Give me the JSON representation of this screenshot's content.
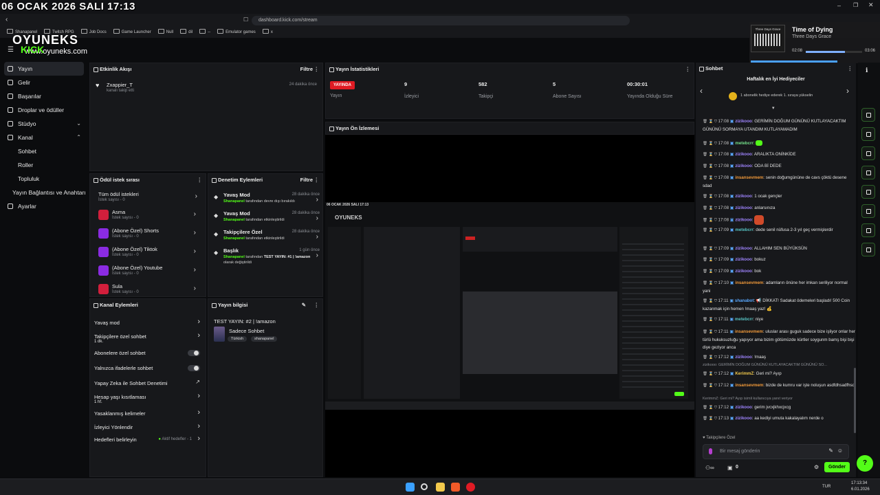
{
  "overlay": {
    "datetime": "06 OCAK 2026 SALI 17:13",
    "brand": "OYUNEKS",
    "brand_site": "www.oyuneks.com",
    "brand_sub": "KICK"
  },
  "browser": {
    "url": "dashboard.kick.com/stream",
    "bookmarks": [
      "Shanapanel",
      "Twitch RPG",
      "Job Docs",
      "Game Launcher",
      "Null",
      "dil",
      "--",
      "Emulator games",
      "x"
    ]
  },
  "media": {
    "title": "Time of Dying",
    "artist": "Three Days Grace",
    "elapsed": "02:08",
    "total": "03:06",
    "album_text": "Three Days Grace",
    "progress": 0.69
  },
  "sidebar": {
    "items": [
      {
        "label": "Yayın",
        "icon": "broadcast-icon"
      },
      {
        "label": "Gelir",
        "icon": "money-icon"
      },
      {
        "label": "Başarılar",
        "icon": "trophy-icon"
      },
      {
        "label": "Droplar ve ödüller",
        "icon": "gift-icon"
      },
      {
        "label": "Stüdyo",
        "icon": "studio-icon"
      },
      {
        "label": "Kanal",
        "icon": "channel-icon"
      },
      {
        "label": "Sohbet"
      },
      {
        "label": "Roller"
      },
      {
        "label": "Topluluk"
      },
      {
        "label": "Yayın Bağlantısı ve Anahtarı"
      },
      {
        "label": "Ayarlar",
        "icon": "settings-icon"
      }
    ]
  },
  "activity": {
    "title": "Etkinlik Akışı",
    "filter": "Filtre",
    "events": [
      {
        "user": "Zxappier_T",
        "text": "kanalı takip etti",
        "time": "24 dakika önce"
      }
    ]
  },
  "stats": {
    "title": "Yayın İstatistikleri",
    "items": [
      {
        "value": "YAYINDA",
        "label": "Yayın"
      },
      {
        "value": "9",
        "label": "İzleyici"
      },
      {
        "value": "582",
        "label": "Takipçi"
      },
      {
        "value": "5",
        "label": "Abone Sayısı"
      },
      {
        "value": "00:30:01",
        "label": "Yayında Olduğu Süre"
      }
    ]
  },
  "preview": {
    "title": "Yayın Ön İzlemesi",
    "inner_banner": "06 OCAK 2026 SALI 17:13",
    "inner_brand": "OYUNEKS"
  },
  "rewards": {
    "title": "Ödül istek sırası",
    "all": {
      "label": "Tüm ödül istekleri",
      "count": "İstek sayısı - 0"
    },
    "items": [
      {
        "label": "Asma",
        "count": "İstek sayısı - 0",
        "color": "#d21f3c"
      },
      {
        "label": "(Abone Özel) Shorts",
        "count": "İstek sayısı - 0",
        "color": "#8a2be2"
      },
      {
        "label": "(Abone Özel) Tiktok",
        "count": "İstek sayısı - 0",
        "color": "#8a2be2"
      },
      {
        "label": "(Abone Özel) Youtube",
        "count": "İstek sayısı - 0",
        "color": "#8a2be2"
      },
      {
        "label": "Sula",
        "count": "İstek sayısı - 0",
        "color": "#d21f3c"
      }
    ]
  },
  "moderation": {
    "title": "Denetim Eylemleri",
    "filter": "Filtre",
    "items": [
      {
        "title": "Yavaş Mod",
        "time": "28 dakika önce",
        "actor": "Shanapanel",
        "text": "tarafından devre dışı bırakıldı"
      },
      {
        "title": "Yavaş Mod",
        "time": "28 dakika önce",
        "actor": "Shanapanel",
        "text": "tarafından etkinleştirildi"
      },
      {
        "title": "Takipçilere Özel",
        "time": "28 dakika önce",
        "actor": "Shanapanel",
        "text": "tarafından etkinleştirildi"
      },
      {
        "title": "Başlık",
        "time": "1 gün önce",
        "actor": "Shanapanel",
        "text": "tarafından",
        "bold": "TEST YAYIN: #1 | !amazon",
        "text2": "olarak değiştirildi"
      }
    ]
  },
  "channel_actions": {
    "title": "Kanal Eylemleri",
    "items": [
      {
        "label": "Yavaş mod"
      },
      {
        "label": "Takipçilere özel sohbet",
        "sub": "1 dk."
      },
      {
        "label": "Abonelere özel sohbet"
      },
      {
        "label": "Yalnızca ifadelerle sohbet"
      },
      {
        "label": "Yapay Zeka ile Sohbet Denetimi"
      },
      {
        "label": "Hesap yaşı kısıtlaması",
        "sub": "1 hf."
      },
      {
        "label": "Yasaklanmış kelimeler"
      },
      {
        "label": "İzleyici Yönlendir"
      },
      {
        "label": "Hedefleri belirleyin",
        "status": "Aktif hedefler - 1"
      }
    ]
  },
  "stream_info": {
    "title": "Yayın bilgisi",
    "stream_title": "TEST YAYIN: #2 | !amazon",
    "category": "Sadece Sohbet",
    "tags": [
      "Türkish",
      "shanapanel"
    ]
  },
  "chat": {
    "title": "Sohbet",
    "gifters_title": "Haftalık en İyi Hediyeciler",
    "gifters_text": "1 abonelik hediye ederek 1. sıraya yükselin",
    "messages": [
      {
        "time": "17:08",
        "user": "zizikooo",
        "color": "purple",
        "text": "GERİMİN DOĞUM GÜNÜNÜ KUTLAYACAKTIM GÜNÜNÜ SORMAYA UTANDIM KUTLAYAMADIM"
      },
      {
        "time": "17:08",
        "user": "metebcrr",
        "color": "green",
        "text": ""
      },
      {
        "time": "17:08",
        "user": "zizikooo",
        "color": "purple",
        "text": "ARALIKTA ONİNKİDE"
      },
      {
        "time": "17:08",
        "user": "zizikooo",
        "color": "purple",
        "text": "ODA Bİ DEDE"
      },
      {
        "time": "17:08",
        "user": "insansevmem",
        "color": "orange",
        "text": "senin doğumgününe de cavs çöktü desene sdad"
      },
      {
        "time": "17:08",
        "user": "zizikooo",
        "color": "purple",
        "text": "1 ocak gençler"
      },
      {
        "time": "17:08",
        "user": "zizikooo",
        "color": "purple",
        "text": "anlarsınıza"
      },
      {
        "time": "17:08",
        "user": "zizikooo",
        "color": "purple",
        "text": ""
      },
      {
        "time": "17:09",
        "user": "metebcrr",
        "color": "teal",
        "text": "dede senil nüfusa 2-3 yıl geç vermişlerdir"
      },
      {
        "time": "17:09",
        "user": "zizikooo",
        "color": "purple",
        "text": "ALLAHIM SEN BÜYÜKSÜN"
      },
      {
        "time": "17:09",
        "user": "zizikooo",
        "color": "purple",
        "text": "bokuz"
      },
      {
        "time": "17:09",
        "user": "zizikooo",
        "color": "purple",
        "text": "bok"
      },
      {
        "time": "17:10",
        "user": "insansevmem",
        "color": "orange",
        "text": "adamların önüne her imkan seriliyor normal yani"
      },
      {
        "time": "17:11",
        "user": "shanabot",
        "color": "blue",
        "text": "📢 DİKKAT! Sadakat ödemeleri başladı! 500 Coin kazanmak için hemen !maaş yaz! 💰"
      },
      {
        "time": "17:11",
        "user": "metebcrr",
        "color": "teal",
        "text": "niye"
      },
      {
        "time": "17:11",
        "user": "insansevmem",
        "color": "orange",
        "text": "uluslar arası guguk sadece bize işliyor onlar her türlü hukuksuzluğu yapıyor ama bizim götümüzde kürtler soygunm bamş bişi bişi diye geziyor anca"
      },
      {
        "time": "17:12",
        "user": "zizikooo",
        "color": "purple",
        "text": "!maaş"
      },
      {
        "reply": "zizikooo: GERİMİN DOĞUM GÜNÜNÜ KUTLAYACAKTIM GÜNÜNÜ SO...",
        "time": "17:12",
        "user": "KerimmZ",
        "color": "yellow",
        "text": "Geri mi? Ayıp"
      },
      {
        "time": "17:12",
        "user": "insansevmem",
        "color": "orange",
        "text": "bizde de kumru var işte noluşun asdfdhsadfhsd"
      },
      {
        "reply": "KerimmZ: Geri mi? Ayıp isimli kullanıcıya yanıt veriyor",
        "time": "17:12",
        "user": "zizikooo",
        "color": "purple",
        "text": "gerim jvcxjkhxcjxcg"
      },
      {
        "time": "17:13",
        "user": "zizikooo",
        "color": "purple",
        "text": "aa kediyi umuta kakalayalım nerde o"
      }
    ],
    "followers_only": "Takipçilere Özel",
    "input_placeholder": "Bir mesaj gönderin",
    "send": "Gönder",
    "points": "0"
  },
  "taskbar": {
    "lang": "TUR",
    "time": "17:13:34",
    "date": "6.01.2026"
  }
}
